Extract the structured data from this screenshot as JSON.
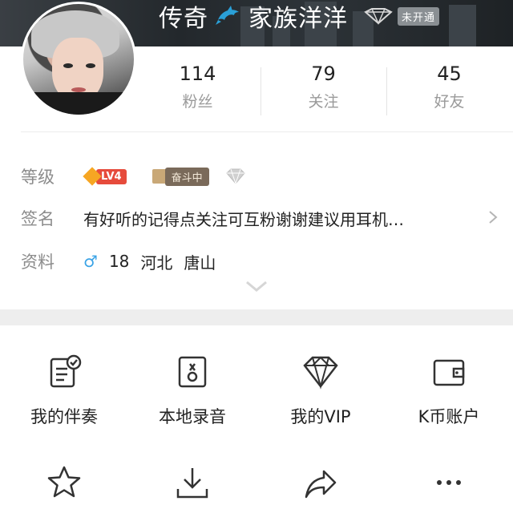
{
  "header": {
    "nickname_prefix": "传奇",
    "nickname_suffix": "家族洋洋",
    "vip_status": "未开通",
    "icons": {
      "nickname_emblem": "dolphin-icon",
      "vip": "vip-diamond-icon"
    }
  },
  "stats": [
    {
      "count": "114",
      "label": "粉丝"
    },
    {
      "count": "79",
      "label": "关注"
    },
    {
      "count": "45",
      "label": "好友"
    }
  ],
  "profile": {
    "level": {
      "key": "等级",
      "badge": "LV4",
      "fendou": "奋斗中"
    },
    "signature": {
      "key": "签名",
      "text": "有好听的记得点关注可互粉谢谢建议用耳机…"
    },
    "info": {
      "key": "资料",
      "gender_icon": "male-icon",
      "gender_symbol": "♂",
      "age": "18",
      "province": "河北",
      "city": "唐山"
    }
  },
  "menu_row1": [
    {
      "icon": "accompaniment-icon",
      "label": "我的伴奏"
    },
    {
      "icon": "local-recording-icon",
      "label": "本地录音"
    },
    {
      "icon": "vip-diamond-icon",
      "label": "我的VIP"
    },
    {
      "icon": "wallet-icon",
      "label": "K币账户"
    }
  ],
  "menu_row2": [
    {
      "icon": "star-icon"
    },
    {
      "icon": "download-icon"
    },
    {
      "icon": "share-icon"
    },
    {
      "icon": "more-icon"
    }
  ],
  "colors": {
    "accent_blue": "#3aa3e6",
    "level_red": "#e64b3c",
    "level_orange": "#f6a623",
    "muted_text": "#8c8c8c"
  }
}
